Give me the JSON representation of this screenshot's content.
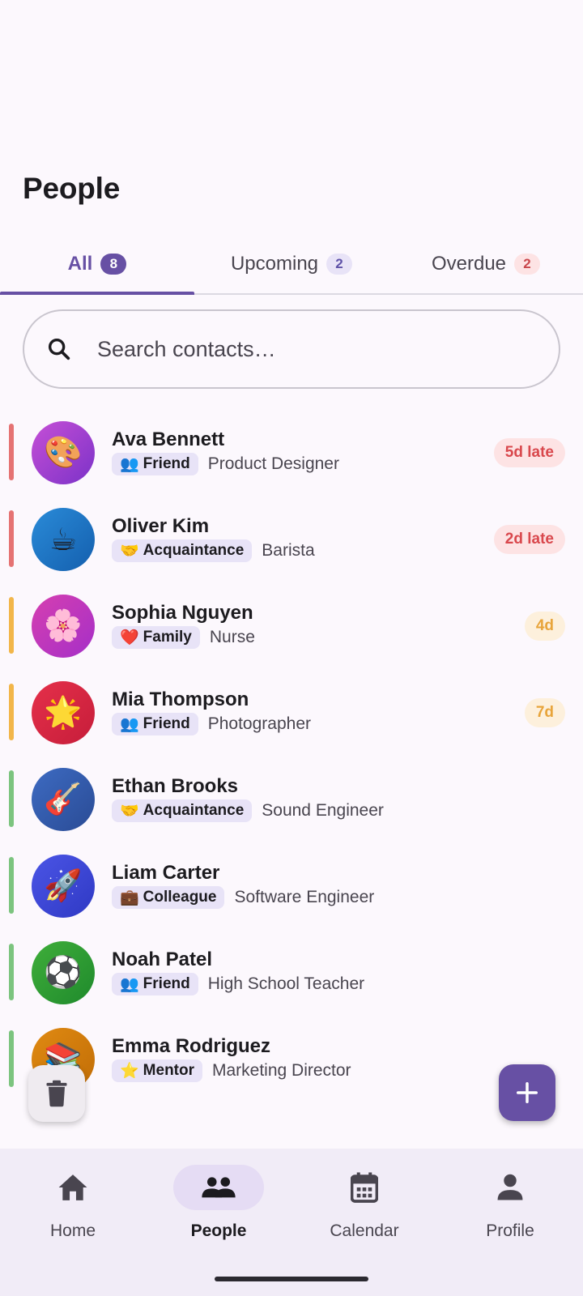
{
  "header": {
    "title": "People"
  },
  "tabs": [
    {
      "label": "All",
      "count": "8",
      "active": true
    },
    {
      "label": "Upcoming",
      "count": "2",
      "active": false
    },
    {
      "label": "Overdue",
      "count": "2",
      "active": false
    }
  ],
  "search": {
    "placeholder": "Search contacts…",
    "icon": "search-icon"
  },
  "contacts": [
    {
      "name": "Ava Bennett",
      "avatar_emoji": "🎨",
      "avatar_colors": [
        "#c64fd6",
        "#7b32c8"
      ],
      "tag_emoji": "👥",
      "tag": "Friend",
      "role": "Product Designer",
      "status": "5d late",
      "status_type": "late",
      "stripe_color": "#e57373"
    },
    {
      "name": "Oliver Kim",
      "avatar_emoji": "☕",
      "avatar_colors": [
        "#2a8bd8",
        "#145fae"
      ],
      "tag_emoji": "🤝",
      "tag": "Acquaintance",
      "role": "Barista",
      "status": "2d late",
      "status_type": "late",
      "stripe_color": "#e57373"
    },
    {
      "name": "Sophia Nguyen",
      "avatar_emoji": "🌸",
      "avatar_colors": [
        "#d63fb0",
        "#a52fc8"
      ],
      "tag_emoji": "❤️",
      "tag": "Family",
      "role": "Nurse",
      "status": "4d",
      "status_type": "soon",
      "stripe_color": "#f2b64a"
    },
    {
      "name": "Mia Thompson",
      "avatar_emoji": "🌟",
      "avatar_colors": [
        "#e5304a",
        "#c61d3a"
      ],
      "tag_emoji": "👥",
      "tag": "Friend",
      "role": "Photographer",
      "status": "7d",
      "status_type": "soon",
      "stripe_color": "#f2b64a"
    },
    {
      "name": "Ethan Brooks",
      "avatar_emoji": "🎸",
      "avatar_colors": [
        "#3d6bc2",
        "#2a4b95"
      ],
      "tag_emoji": "🤝",
      "tag": "Acquaintance",
      "role": "Sound Engineer",
      "status": "",
      "status_type": "none",
      "stripe_color": "#7cc47f"
    },
    {
      "name": "Liam Carter",
      "avatar_emoji": "🚀",
      "avatar_colors": [
        "#4b55e6",
        "#2f39c4"
      ],
      "tag_emoji": "💼",
      "tag": "Colleague",
      "role": "Software Engineer",
      "status": "",
      "status_type": "none",
      "stripe_color": "#7cc47f"
    },
    {
      "name": "Noah Patel",
      "avatar_emoji": "⚽",
      "avatar_colors": [
        "#3fae3a",
        "#1f8a2c"
      ],
      "tag_emoji": "👥",
      "tag": "Friend",
      "role": "High School Teacher",
      "status": "",
      "status_type": "none",
      "stripe_color": "#7cc47f"
    },
    {
      "name": "Emma Rodriguez",
      "avatar_emoji": "📚",
      "avatar_colors": [
        "#e08a12",
        "#c16d06"
      ],
      "tag_emoji": "⭐",
      "tag": "Mentor",
      "role": "Marketing Director",
      "status": "",
      "status_type": "none",
      "stripe_color": "#7cc47f"
    }
  ],
  "fab": {
    "delete_icon": "trash-icon",
    "add_icon": "plus-icon"
  },
  "bottom_nav": [
    {
      "label": "Home",
      "icon": "home-icon",
      "active": false
    },
    {
      "label": "People",
      "icon": "people-icon",
      "active": true
    },
    {
      "label": "Calendar",
      "icon": "calendar-icon",
      "active": false
    },
    {
      "label": "Profile",
      "icon": "person-icon",
      "active": false
    }
  ],
  "colors": {
    "accent": "#6750a4",
    "late": "#d9484d",
    "soon": "#e8a43a",
    "ok": "#7cc47f"
  }
}
